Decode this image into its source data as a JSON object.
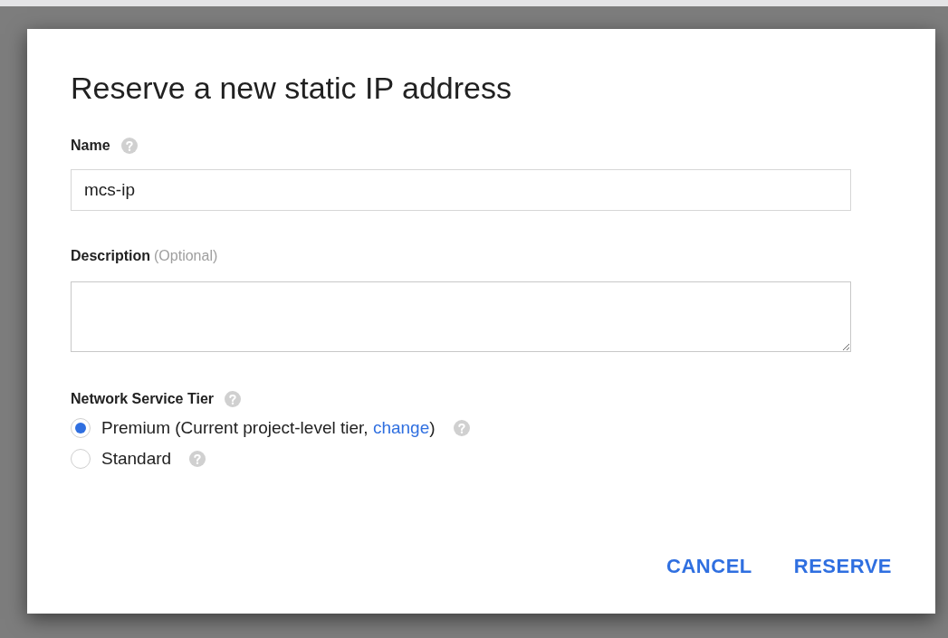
{
  "dialog": {
    "title": "Reserve a new static IP address",
    "name_field": {
      "label": "Name",
      "value": "mcs-ip"
    },
    "description_field": {
      "label": "Description",
      "hint": "(Optional)"
    },
    "tier": {
      "label": "Network Service Tier",
      "options": [
        {
          "text": "Premium (Current project-level tier, ",
          "link": "change",
          "suffix": ")",
          "selected": true
        },
        {
          "text": "Standard",
          "selected": false
        }
      ]
    },
    "buttons": [
      "CANCEL",
      "RESERVE"
    ]
  }
}
